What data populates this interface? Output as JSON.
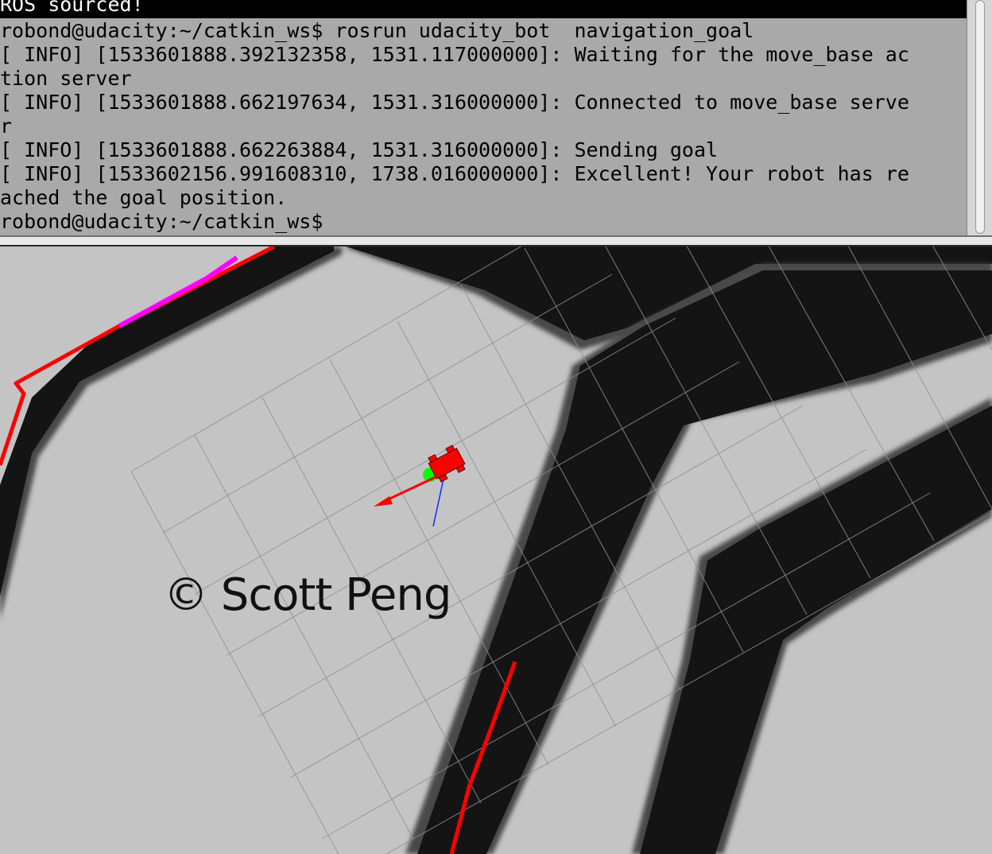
{
  "terminal": {
    "header": "ROS sourced!",
    "lines": [
      "robond@udacity:~/catkin_ws$ rosrun udacity_bot  navigation_goal",
      "[ INFO] [1533601888.392132358, 1531.117000000]: Waiting for the move_base ac",
      "tion server",
      "[ INFO] [1533601888.662197634, 1531.316000000]: Connected to move_base serve",
      "r",
      "[ INFO] [1533601888.662263884, 1531.316000000]: Sending goal",
      "[ INFO] [1533602156.991608310, 1738.016000000]: Excellent! Your robot has re",
      "ached the goal position.",
      "robond@udacity:~/catkin_ws$"
    ]
  },
  "rviz": {
    "watermark": "© Scott Peng",
    "colors": {
      "free_space": "#c4c4c4",
      "wall": "#141414",
      "inflation": "#4a4a4a",
      "global_plan": "#ff0000",
      "local_plan": "#ff00ff",
      "robot": "#ff0000",
      "grid": "#8f8f8f",
      "x_axis": "#ff0000",
      "z_axis": "#0033ff",
      "goal_marker": "#00ff00"
    }
  }
}
